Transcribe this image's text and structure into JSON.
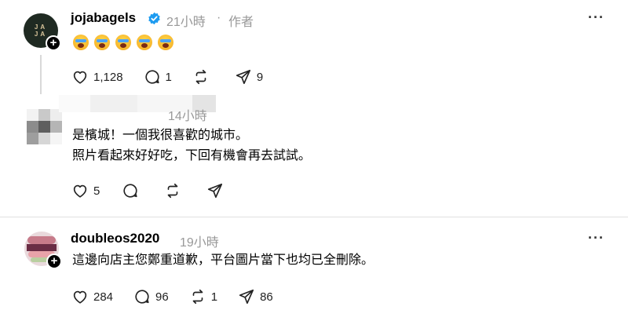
{
  "post1": {
    "username": "jojabagels",
    "verified": true,
    "time": "21小時",
    "separator": "·",
    "author_tag": "作者",
    "emoji_count": 5,
    "likes": "1,128",
    "replies": "1",
    "reposts": "",
    "shares": "9",
    "avatar_text": "JA JA",
    "avatar_color": "#1f2a22"
  },
  "reply": {
    "time": "14小時",
    "line1": "是檳城！一個我很喜歡的城市。",
    "line2": "照片看起來好好吃，下回有機會再去試試。",
    "likes": "5"
  },
  "post2": {
    "username": "doubleos2020",
    "time": "19小時",
    "text": "這邊向店主您鄭重道歉，平台圖片當下也均已全刪除。",
    "likes": "284",
    "replies": "96",
    "reposts": "1",
    "shares": "86"
  },
  "icons": {
    "like": "heart-icon",
    "reply": "comment-icon",
    "repost": "repost-icon",
    "share": "send-icon",
    "more": "more-icon",
    "verified": "verified-badge-icon"
  },
  "colors": {
    "verified": "#1d9bf0",
    "meta": "#999999"
  }
}
